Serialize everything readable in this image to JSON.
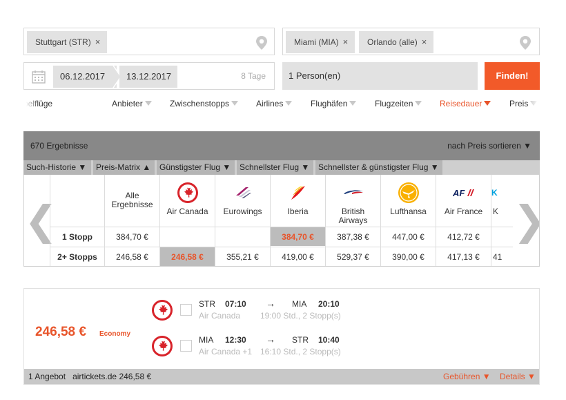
{
  "search": {
    "origin_chip": "Stuttgart (STR)",
    "dest_chips": [
      "Miami (MIA)",
      "Orlando (alle)"
    ],
    "close_glyph": "×",
    "date_from": "06.12.2017",
    "date_to": "13.12.2017",
    "days": "8 Tage",
    "persons": "1 Person(en)",
    "submit": "Finden!"
  },
  "filters": [
    {
      "label": "belflüge"
    },
    {
      "label": "Anbieter"
    },
    {
      "label": "Zwischenstopps"
    },
    {
      "label": "Airlines"
    },
    {
      "label": "Flughäfen"
    },
    {
      "label": "Flugzeiten"
    },
    {
      "label": "Reisedauer"
    },
    {
      "label": "Preis"
    }
  ],
  "results": {
    "count": "670 Ergebnisse",
    "sort": "nach Preis sortieren ▼",
    "tabs": [
      "Such-Historie ▼",
      "Preis-Matrix ▲",
      "Günstigster Flug ▼",
      "Schnellster Flug ▼",
      "Schnellster & günstigster Flug ▼"
    ]
  },
  "matrix": {
    "prev": "❮",
    "next": "❯",
    "all_label": "Alle Ergebnisse",
    "row_labels": [
      "1 Stopp",
      "2+ Stopps"
    ],
    "all_values": [
      "384,70 €",
      "246,58 €"
    ],
    "airlines": [
      {
        "name": "Air Canada",
        "one_stop": "",
        "two_stops": "246,58 €",
        "hl": 1,
        "logo": "air-canada-logo"
      },
      {
        "name": "Eurowings",
        "one_stop": "",
        "two_stops": "355,21 €",
        "hl": -1,
        "logo": "eurowings-logo"
      },
      {
        "name": "Iberia",
        "one_stop": "384,70 €",
        "two_stops": "419,00 €",
        "hl": 0,
        "logo": "iberia-logo"
      },
      {
        "name": "British Airways",
        "one_stop": "387,38 €",
        "two_stops": "529,37 €",
        "hl": -1,
        "logo": "british-airways-logo"
      },
      {
        "name": "Lufthansa",
        "one_stop": "447,00 €",
        "two_stops": "390,00 €",
        "hl": -1,
        "logo": "lufthansa-logo"
      },
      {
        "name": "Air France",
        "one_stop": "412,72 €",
        "two_stops": "417,13 €",
        "hl": -1,
        "logo": "air-france-logo"
      },
      {
        "name": "K",
        "one_stop": "",
        "two_stops": "41",
        "hl": -1,
        "logo": "klm-logo"
      }
    ]
  },
  "offer": {
    "price": "246,58 €",
    "class": "Economy",
    "legs": [
      {
        "from": "STR",
        "dep": "07:10",
        "arrow": "→",
        "to": "MIA",
        "arr": "20:10",
        "airline": "Air Canada",
        "info": "19:00 Std., 2 Stopp(s)"
      },
      {
        "from": "MIA",
        "dep": "12:30",
        "arrow": "→",
        "to": "STR",
        "arr": "10:40",
        "airline": "Air Canada +1",
        "info": "16:10 Std., 2 Stopp(s)"
      }
    ],
    "footer_offers": "1 Angebot",
    "footer_provider": "airtickets.de 246,58 €",
    "fees": "Gebühren ▼",
    "details": "Details ▼"
  },
  "colors": {
    "accent": "#e8542a",
    "button": "#f25a29"
  }
}
